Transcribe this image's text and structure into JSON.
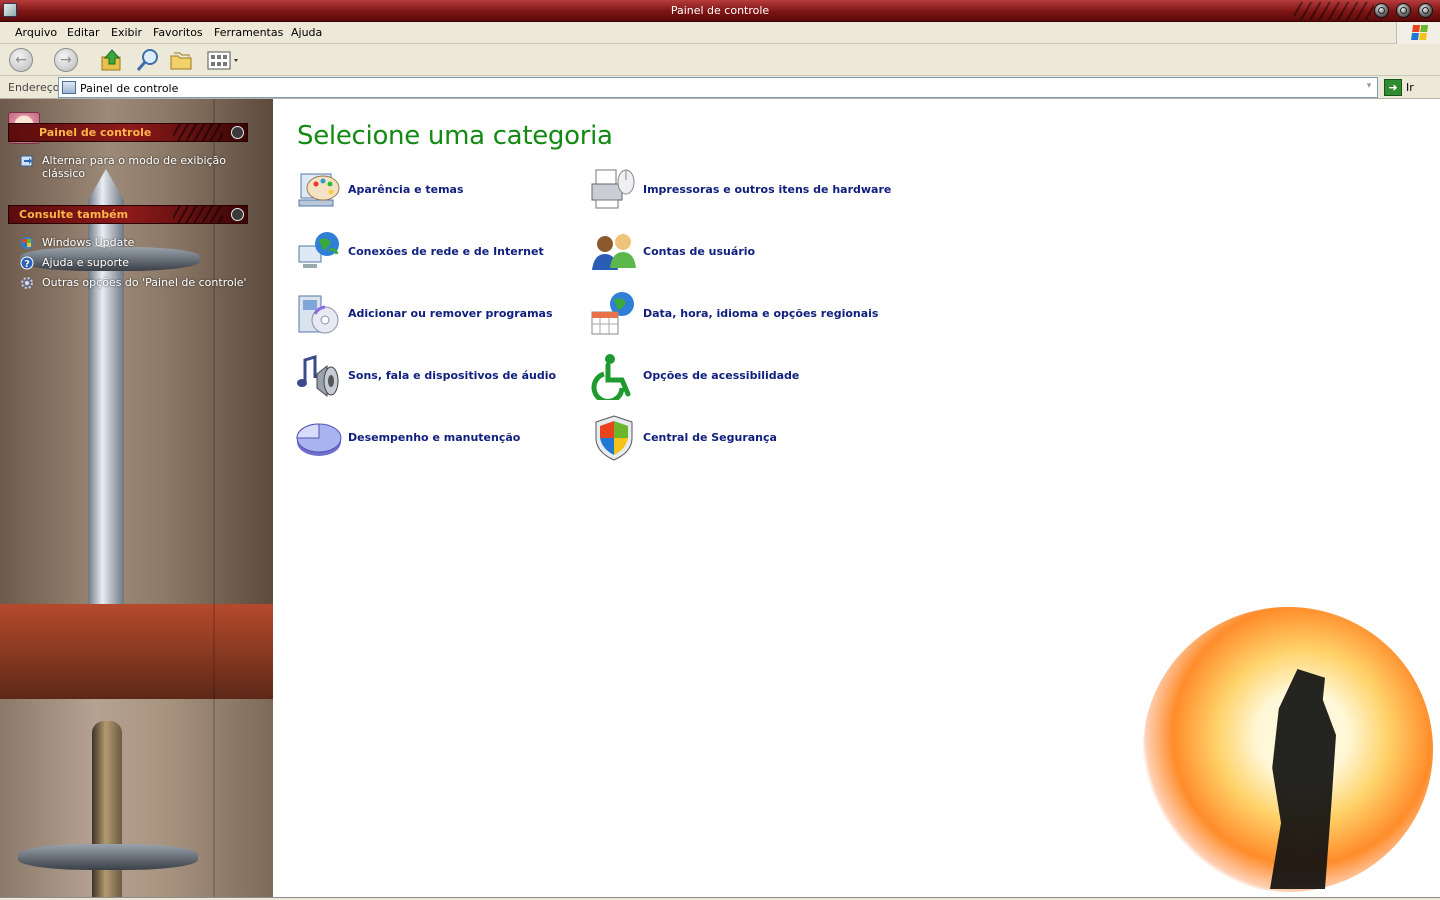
{
  "window": {
    "title": "Painel de controle"
  },
  "menubar": {
    "items": [
      "Arquivo",
      "Editar",
      "Exibir",
      "Favoritos",
      "Ferramentas",
      "Ajuda"
    ]
  },
  "toolbar": {
    "back_icon": "back-arrow-icon",
    "forward_icon": "forward-arrow-icon",
    "up_icon": "up-folder-icon",
    "search_icon": "search-icon",
    "folders_icon": "folders-icon",
    "views_icon": "views-icon"
  },
  "address": {
    "label": "Endereço",
    "value": "Painel de controle",
    "go_label": "Ir"
  },
  "sidebar": {
    "panel1": {
      "title": "Painel de controle",
      "items": [
        {
          "label": "Alternar para o modo de exibição clássico",
          "icon": "switch-view-icon"
        }
      ]
    },
    "panel2": {
      "title": "Consulte também",
      "items": [
        {
          "label": "Windows Update",
          "icon": "windows-update-icon"
        },
        {
          "label": "Ajuda e suporte",
          "icon": "help-icon"
        },
        {
          "label": "Outras opções do 'Painel de controle'",
          "icon": "gear-icon"
        }
      ]
    }
  },
  "main": {
    "heading": "Selecione uma categoria",
    "categories": [
      {
        "label": "Aparência e temas",
        "icon": "appearance-palette-icon"
      },
      {
        "label": "Impressoras e outros itens de hardware",
        "icon": "printer-icon"
      },
      {
        "label": "Conexões de rede e de Internet",
        "icon": "network-globe-icon"
      },
      {
        "label": "Contas de usuário",
        "icon": "user-accounts-icon"
      },
      {
        "label": "Adicionar ou remover programas",
        "icon": "add-remove-programs-icon"
      },
      {
        "label": "Data, hora, idioma e opções regionais",
        "icon": "date-time-globe-icon"
      },
      {
        "label": "Sons, fala e dispositivos de áudio",
        "icon": "sound-speaker-icon"
      },
      {
        "label": "Opções de acessibilidade",
        "icon": "accessibility-icon"
      },
      {
        "label": "Desempenho e manutenção",
        "icon": "performance-pie-icon"
      },
      {
        "label": "Central de Segurança",
        "icon": "security-shield-icon"
      }
    ]
  },
  "colors": {
    "heading": "#138a13",
    "link": "#11207e",
    "titlebar": "#7e1414",
    "sidebar_header_text": "#ffb44a"
  }
}
